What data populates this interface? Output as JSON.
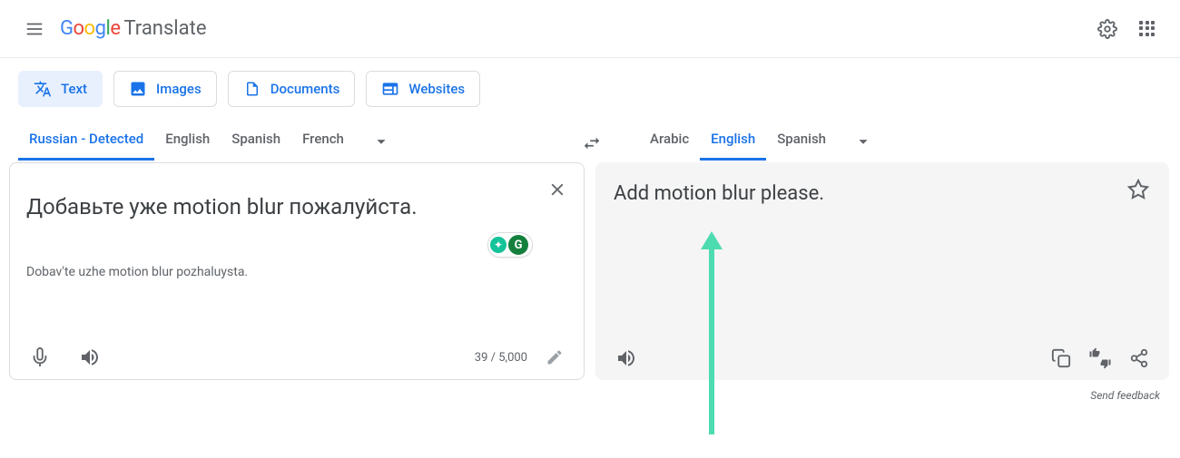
{
  "header": {
    "logo_product": "Translate"
  },
  "modes": {
    "text": "Text",
    "images": "Images",
    "documents": "Documents",
    "websites": "Websites"
  },
  "source_langs": {
    "detected": "Russian - Detected",
    "l1": "English",
    "l2": "Spanish",
    "l3": "French"
  },
  "target_langs": {
    "l1": "Arabic",
    "l2": "English",
    "l3": "Spanish"
  },
  "source": {
    "text": "Добавьте уже motion blur пожалуйста.",
    "transliteration": "Dobav'te uzhe motion blur pozhaluysta.",
    "char_count": "39 / 5,000"
  },
  "target": {
    "text": "Add motion blur please."
  },
  "feedback_label": "Send feedback"
}
